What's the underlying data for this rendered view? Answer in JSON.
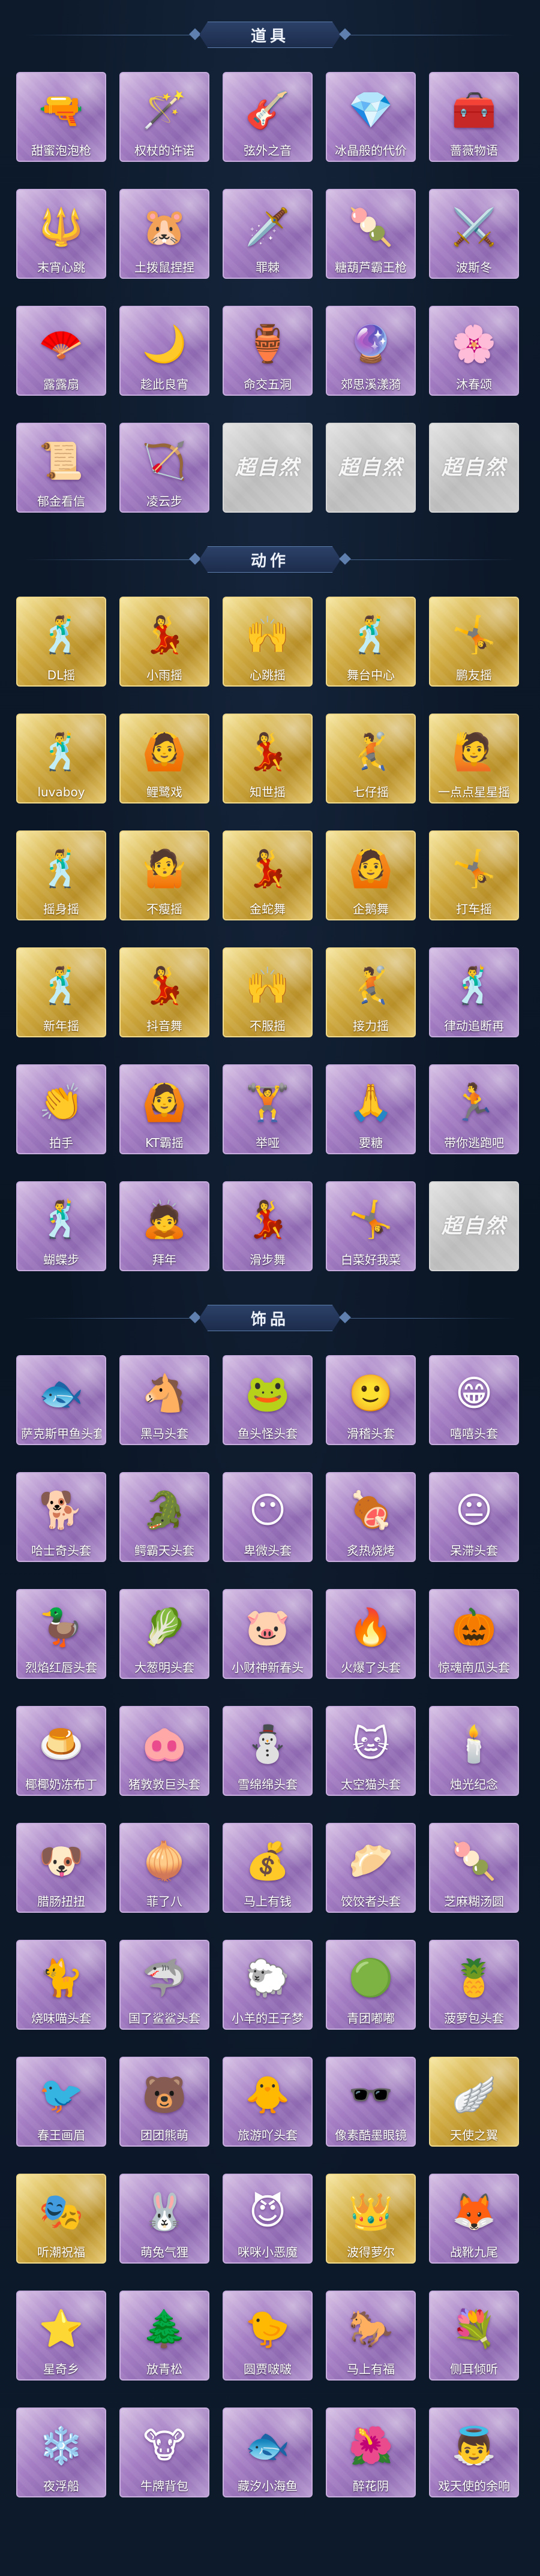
{
  "sections": {
    "props": {
      "title": "道具",
      "items": [
        {
          "label": "甜蜜泡泡枪",
          "icon": "bubble-gun-icon",
          "glyph": "🔫",
          "rarity": "purple"
        },
        {
          "label": "权杖的许诺",
          "icon": "scepter-icon",
          "glyph": "🪄",
          "rarity": "purple"
        },
        {
          "label": "弦外之音",
          "icon": "guitar-icon",
          "glyph": "🎸",
          "rarity": "purple"
        },
        {
          "label": "冰晶般的代价",
          "icon": "ice-crystal-icon",
          "glyph": "💎",
          "rarity": "purple"
        },
        {
          "label": "蔷薇物语",
          "icon": "first-aid-box-icon",
          "glyph": "🧰",
          "rarity": "purple"
        },
        {
          "label": "末宵心跳",
          "icon": "staff-icon",
          "glyph": "🔱",
          "rarity": "purple"
        },
        {
          "label": "土拨鼠捏捏",
          "icon": "groundhog-icon",
          "glyph": "🐹",
          "rarity": "purple"
        },
        {
          "label": "罪棘",
          "icon": "thorn-sword-icon",
          "glyph": "🗡️",
          "rarity": "purple"
        },
        {
          "label": "糖葫芦霸王枪",
          "icon": "candy-spear-icon",
          "glyph": "🍡",
          "rarity": "purple"
        },
        {
          "label": "波斯冬",
          "icon": "winter-blade-icon",
          "glyph": "⚔️",
          "rarity": "purple"
        },
        {
          "label": "露露扇",
          "icon": "fan-icon",
          "glyph": "🪭",
          "rarity": "purple"
        },
        {
          "label": "趁此良宵",
          "icon": "night-cloud-icon",
          "glyph": "🌙",
          "rarity": "purple"
        },
        {
          "label": "命交五洞",
          "icon": "bottle-icon",
          "glyph": "🏺",
          "rarity": "purple"
        },
        {
          "label": "郊思溪漾漪",
          "icon": "purple-orb-icon",
          "glyph": "🔮",
          "rarity": "purple"
        },
        {
          "label": "沐春颂",
          "icon": "flower-branch-icon",
          "glyph": "🌸",
          "rarity": "purple"
        },
        {
          "label": "郁金看信",
          "icon": "paper-fan-icon",
          "glyph": "📜",
          "rarity": "purple"
        },
        {
          "label": "凌云步",
          "icon": "bow-icon",
          "glyph": "🏹",
          "rarity": "purple"
        },
        {
          "label": "",
          "icon": "placeholder-logo",
          "glyph": "",
          "rarity": "gray",
          "watermark": "超自然"
        },
        {
          "label": "",
          "icon": "placeholder-logo",
          "glyph": "",
          "rarity": "gray",
          "watermark": "超自然"
        },
        {
          "label": "",
          "icon": "placeholder-logo",
          "glyph": "",
          "rarity": "gray",
          "watermark": "超自然"
        }
      ]
    },
    "actions": {
      "title": "动作",
      "items": [
        {
          "label": "DL摇",
          "icon": "dance-pose-icon",
          "glyph": "🕺",
          "rarity": "gold"
        },
        {
          "label": "小雨摇",
          "icon": "dance-pose-icon",
          "glyph": "💃",
          "rarity": "gold"
        },
        {
          "label": "心跳摇",
          "icon": "dance-pose-icon",
          "glyph": "🙌",
          "rarity": "gold"
        },
        {
          "label": "舞台中心",
          "icon": "dance-pose-icon",
          "glyph": "🕺",
          "rarity": "gold"
        },
        {
          "label": "鹏友摇",
          "icon": "dance-pose-icon",
          "glyph": "🤸",
          "rarity": "gold"
        },
        {
          "label": "luvaboy",
          "icon": "dance-pose-icon",
          "glyph": "🕺",
          "rarity": "gold"
        },
        {
          "label": "鲤鹭戏",
          "icon": "dance-pose-icon",
          "glyph": "🙆",
          "rarity": "gold"
        },
        {
          "label": "知世摇",
          "icon": "dance-pose-icon",
          "glyph": "💃",
          "rarity": "gold"
        },
        {
          "label": "七仔摇",
          "icon": "dance-pose-icon",
          "glyph": "🤾",
          "rarity": "gold"
        },
        {
          "label": "一点点星星摇",
          "icon": "dance-pose-icon",
          "glyph": "🙋",
          "rarity": "gold"
        },
        {
          "label": "摇身摇",
          "icon": "dance-pose-icon",
          "glyph": "🕺",
          "rarity": "gold"
        },
        {
          "label": "不瘦摇",
          "icon": "dance-pose-icon",
          "glyph": "🤷",
          "rarity": "gold"
        },
        {
          "label": "金蛇舞",
          "icon": "dance-pose-icon",
          "glyph": "💃",
          "rarity": "gold"
        },
        {
          "label": "企鹅舞",
          "icon": "dance-pose-icon",
          "glyph": "🙆",
          "rarity": "gold"
        },
        {
          "label": "打车摇",
          "icon": "dance-pose-icon",
          "glyph": "🤸",
          "rarity": "gold"
        },
        {
          "label": "新年摇",
          "icon": "dance-pose-icon",
          "glyph": "🕺",
          "rarity": "gold"
        },
        {
          "label": "抖音舞",
          "icon": "dance-pose-icon",
          "glyph": "💃",
          "rarity": "gold"
        },
        {
          "label": "不服摇",
          "icon": "dance-pose-icon",
          "glyph": "🙌",
          "rarity": "gold"
        },
        {
          "label": "接力摇",
          "icon": "dance-pose-icon",
          "glyph": "🤾",
          "rarity": "gold"
        },
        {
          "label": "律动追断再",
          "icon": "dance-pose-icon",
          "glyph": "🕺",
          "rarity": "purple"
        },
        {
          "label": "拍手",
          "icon": "clap-pose-icon",
          "glyph": "👏",
          "rarity": "purple"
        },
        {
          "label": "KT霸摇",
          "icon": "dance-pose-icon",
          "glyph": "🙆",
          "rarity": "purple"
        },
        {
          "label": "举哑",
          "icon": "lift-pose-icon",
          "glyph": "🏋️",
          "rarity": "purple"
        },
        {
          "label": "要糖",
          "icon": "ask-pose-icon",
          "glyph": "🙏",
          "rarity": "purple"
        },
        {
          "label": "带你逃跑吧",
          "icon": "run-pose-icon",
          "glyph": "🏃",
          "rarity": "purple"
        },
        {
          "label": "蝴蝶步",
          "icon": "dance-pose-icon",
          "glyph": "🕺",
          "rarity": "purple"
        },
        {
          "label": "拜年",
          "icon": "bow-pose-icon",
          "glyph": "🙇",
          "rarity": "purple"
        },
        {
          "label": "滑步舞",
          "icon": "dance-pose-icon",
          "glyph": "💃",
          "rarity": "purple"
        },
        {
          "label": "白菜好我菜",
          "icon": "dance-pose-icon",
          "glyph": "🤸",
          "rarity": "purple"
        },
        {
          "label": "",
          "icon": "placeholder-logo",
          "glyph": "",
          "rarity": "gray",
          "watermark": "超自然"
        }
      ]
    },
    "accessories": {
      "title": "饰品",
      "items": [
        {
          "label": "萨克斯甲鱼头套",
          "icon": "fish-head-icon",
          "glyph": "🐟",
          "rarity": "purple"
        },
        {
          "label": "黑马头套",
          "icon": "horse-head-icon",
          "glyph": "🐴",
          "rarity": "purple"
        },
        {
          "label": "鱼头怪头套",
          "icon": "frog-fish-head-icon",
          "glyph": "🐸",
          "rarity": "purple"
        },
        {
          "label": "滑稽头套",
          "icon": "smile-face-icon",
          "glyph": "🙂",
          "rarity": "purple"
        },
        {
          "label": "嘻嘻头套",
          "icon": "grin-face-icon",
          "glyph": "😁",
          "rarity": "purple"
        },
        {
          "label": "哈士奇头套",
          "icon": "husky-head-icon",
          "glyph": "🐕",
          "rarity": "purple"
        },
        {
          "label": "鳄霸天头套",
          "icon": "crocodile-head-icon",
          "glyph": "🐊",
          "rarity": "purple"
        },
        {
          "label": "卑微头套",
          "icon": "shy-face-icon",
          "glyph": "😶",
          "rarity": "purple"
        },
        {
          "label": "炙热烧烤",
          "icon": "grill-head-icon",
          "glyph": "🍖",
          "rarity": "purple"
        },
        {
          "label": "呆滞头套",
          "icon": "blank-face-icon",
          "glyph": "😐",
          "rarity": "purple"
        },
        {
          "label": "烈焰红唇头套",
          "icon": "duck-lips-head-icon",
          "glyph": "🦆",
          "rarity": "purple"
        },
        {
          "label": "大葱明头套",
          "icon": "scallion-head-icon",
          "glyph": "🥬",
          "rarity": "purple"
        },
        {
          "label": "小财神新春头",
          "icon": "fortune-pig-icon",
          "glyph": "🐷",
          "rarity": "purple"
        },
        {
          "label": "火爆了头套",
          "icon": "fire-head-icon",
          "glyph": "🔥",
          "rarity": "purple"
        },
        {
          "label": "惊魂南瓜头套",
          "icon": "pumpkin-head-icon",
          "glyph": "🎃",
          "rarity": "purple"
        },
        {
          "label": "椰椰奶冻布丁",
          "icon": "pudding-head-icon",
          "glyph": "🍮",
          "rarity": "purple"
        },
        {
          "label": "猪敦敦巨头套",
          "icon": "pig-head-icon",
          "glyph": "🐽",
          "rarity": "purple"
        },
        {
          "label": "雪绵绵头套",
          "icon": "snow-head-icon",
          "glyph": "⛄",
          "rarity": "purple"
        },
        {
          "label": "太空猫头套",
          "icon": "space-cat-icon",
          "glyph": "🐱",
          "rarity": "purple"
        },
        {
          "label": "烛光纪念",
          "icon": "candle-head-icon",
          "glyph": "🕯️",
          "rarity": "purple"
        },
        {
          "label": "腊肠扭扭",
          "icon": "dachshund-head-icon",
          "glyph": "🐶",
          "rarity": "purple"
        },
        {
          "label": "菲了八",
          "icon": "turnip-head-icon",
          "glyph": "🧅",
          "rarity": "purple"
        },
        {
          "label": "马上有钱",
          "icon": "money-head-icon",
          "glyph": "💰",
          "rarity": "purple"
        },
        {
          "label": "饺饺者头套",
          "icon": "dumpling-head-icon",
          "glyph": "🥟",
          "rarity": "purple"
        },
        {
          "label": "芝麻糊汤圆",
          "icon": "rice-ball-icon",
          "glyph": "🍡",
          "rarity": "purple"
        },
        {
          "label": "烧味喵头套",
          "icon": "cat-head-icon",
          "glyph": "🐈",
          "rarity": "purple"
        },
        {
          "label": "国了鲨鲨头套",
          "icon": "shark-head-icon",
          "glyph": "🦈",
          "rarity": "purple"
        },
        {
          "label": "小羊的王子梦",
          "icon": "sheep-head-icon",
          "glyph": "🐑",
          "rarity": "purple"
        },
        {
          "label": "青团嘟嘟",
          "icon": "green-bun-icon",
          "glyph": "🟢",
          "rarity": "purple"
        },
        {
          "label": "菠萝包头套",
          "icon": "pineapple-bun-icon",
          "glyph": "🍍",
          "rarity": "purple"
        },
        {
          "label": "春王画眉",
          "icon": "bird-head-icon",
          "glyph": "🐦",
          "rarity": "purple"
        },
        {
          "label": "团团熊萌",
          "icon": "bear-head-icon",
          "glyph": "🐻",
          "rarity": "purple"
        },
        {
          "label": "旅游吖头套",
          "icon": "duck-hat-icon",
          "glyph": "🐥",
          "rarity": "purple"
        },
        {
          "label": "像素酷墨眼镜",
          "icon": "pixel-glasses-icon",
          "glyph": "🕶️",
          "rarity": "purple"
        },
        {
          "label": "天使之翼",
          "icon": "angel-wings-icon",
          "glyph": "🪽",
          "rarity": "gold"
        },
        {
          "label": "听潮祝福",
          "icon": "mask-icon",
          "glyph": "🎭",
          "rarity": "gold"
        },
        {
          "label": "萌兔气狸",
          "icon": "rabbit-ears-icon",
          "glyph": "🐰",
          "rarity": "purple"
        },
        {
          "label": "咪咪小恶魔",
          "icon": "devil-horns-icon",
          "glyph": "😈",
          "rarity": "purple"
        },
        {
          "label": "波得萝尔",
          "icon": "crown-icon",
          "glyph": "👑",
          "rarity": "gold"
        },
        {
          "label": "战靴九尾",
          "icon": "fox-tail-icon",
          "glyph": "🦊",
          "rarity": "purple"
        },
        {
          "label": "星奇乡",
          "icon": "star-icon",
          "glyph": "⭐",
          "rarity": "purple"
        },
        {
          "label": "放青松",
          "icon": "bonsai-icon",
          "glyph": "🌲",
          "rarity": "purple"
        },
        {
          "label": "圆贾啵啵",
          "icon": "chick-icon",
          "glyph": "🐤",
          "rarity": "purple"
        },
        {
          "label": "马上有福",
          "icon": "red-horse-icon",
          "glyph": "🐎",
          "rarity": "purple"
        },
        {
          "label": "侧耳倾听",
          "icon": "flower-ear-icon",
          "glyph": "💐",
          "rarity": "purple"
        },
        {
          "label": "夜浮船",
          "icon": "snowflake-boat-icon",
          "glyph": "❄️",
          "rarity": "purple"
        },
        {
          "label": "牛牌背包",
          "icon": "cow-backpack-icon",
          "glyph": "🐮",
          "rarity": "purple"
        },
        {
          "label": "藏汐小海鱼",
          "icon": "blue-cat-icon",
          "glyph": "🐟",
          "rarity": "purple"
        },
        {
          "label": "醉花阴",
          "icon": "sakura-icon",
          "glyph": "🌺",
          "rarity": "purple"
        },
        {
          "label": "戏天使的余响",
          "icon": "angel-doll-icon",
          "glyph": "👼",
          "rarity": "purple"
        }
      ]
    }
  }
}
